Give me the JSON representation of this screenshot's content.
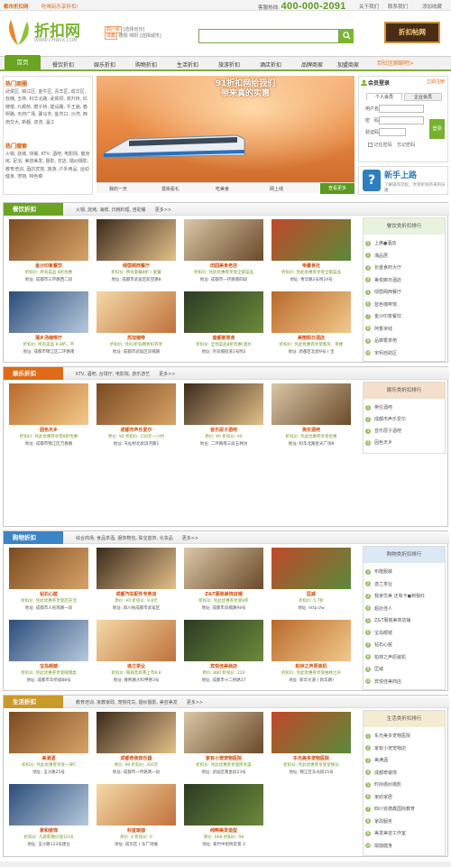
{
  "topbar": {
    "brand": "都市折扣网",
    "slogan": "吃喝玩乐享折扣!",
    "hotline_label": "客服热线:",
    "hotline_number": "400-000-2091",
    "links": [
      "关于我们",
      "联系我们",
      "添加收藏"
    ]
  },
  "header": {
    "logo_cn": "折扣网",
    "logo_en": "WWW.CHWLK.COM",
    "city_current": "四川省",
    "city_select": "[选择省份]",
    "city_row": [
      "成都",
      "德阳",
      "绵阳"
    ],
    "city_select2": "[选择城市]",
    "search_icon": "search-icon",
    "big_button_label": "折扣帖网"
  },
  "nav": {
    "items": [
      "首页",
      "餐饮折扣",
      "娱乐折扣",
      "购物折扣",
      "生活折扣",
      "旅游折扣",
      "酒店折扣",
      "品牌商家",
      "加盟商家"
    ],
    "community": "到社区聊聊吧>"
  },
  "left": {
    "hot_area_title": "热门商圈",
    "hot_area_text": "武侯区, 锦江区, 金牛区, 青羊区, 成华区, 双楠, 玉林, 科华北路, 武侯祠, 高升桥, 红牌楼, 九眼桥, 磨子桥, 建设路, 牛王庙, 春熙路, 天府广场, 骡马市, 盐市口, 沙湾, 西南交大, 新都, 双流, 温江",
    "hot_search_title": "热门搜索",
    "hot_search_text": "火锅, 烧烤, 快餐, KTV, 酒吧, 电影院, 健身房, 足浴, 美容美发, 摄影, 花店, 婚纱摄影, 教育培训, 酒店宾馆, 旅游, 户外用品, 运动健身, 宠物, 特色菜"
  },
  "banner": {
    "headline_1": "91折扣网给我们",
    "headline_2": "带来真的实惠",
    "tabs": [
      "我的一天",
      "逛街看礼",
      "吃美食",
      "网上线"
    ],
    "active_tab": "查看更多"
  },
  "login": {
    "title": "会员登录",
    "register": "立即注册",
    "tabs": [
      "个人会员",
      "企业会员"
    ],
    "user_label": "用户名",
    "pass_label": "密　码",
    "code_label": "验证码",
    "login_button": "登录",
    "remember": "记住密码",
    "forgot": "忘记密码"
  },
  "newuser": {
    "title": "新手上路",
    "text": "了解操作流程，享受折扣带来的乐趣"
  },
  "sections": {
    "food": {
      "tag": "餐饮折扣",
      "keywords": "火锅, 烧烤, 海鲜, 日韩料理, 自助餐　　更多>>",
      "side_title": "餐饮类折扣排行",
      "side_rows": [
        "上席●酒店",
        "湘品居",
        "长盛食府大厅",
        "美悦廊日酒店",
        "绿茵阁西餐厅",
        "蓝色咖啡馆",
        "金沙印象餐饮",
        "阿香米线",
        "品御香茶苑",
        "宋柯自助区"
      ],
      "cards": [
        {
          "title": "金沙印象餐饮",
          "desc": "折扣价: 所有菜品 8折优惠",
          "addr": "地址: 成都市三环路西二段"
        },
        {
          "title": "绿茵阁西餐厅",
          "desc": "折扣价: 所有套餐8折 ( 套餐",
          "addr": "地址: 成都市武侯区航空路8"
        },
        {
          "title": "田园美食老店",
          "desc": "折扣价: 凭此优惠券享受全部菜品",
          "addr": "地址: 成都市一环路南四段"
        },
        {
          "title": "帝豪食社",
          "desc": "折扣价: 凭此优惠券享受全部菜品",
          "addr": "地址: 青华路2号附24号"
        },
        {
          "title": "蒲乡汤咖啡厅",
          "desc": "折扣价: 所有菜品 8.8折，不",
          "addr": "地址: 成都市锦江区二环路南"
        },
        {
          "title": "苏加咖啡",
          "desc": "折扣价: 凭91折扣网折扣券享",
          "addr": "地址: 成都市武侯区双楠路"
        },
        {
          "title": "盘都家常食",
          "desc": "折扣价: 全场菜品8折优惠(酒水",
          "addr": "地址: 外双楠街道1号附2"
        },
        {
          "title": "美丽假日酒店",
          "desc": "折扣价: 凭此优惠券享受客房、茶楼",
          "addr": "地址: 新都区北街9号 ( 宝"
        }
      ]
    },
    "fun": {
      "tag": "娱乐折扣",
      "keywords": "KTV, 酒吧, 台球厅, 电影院, 游乐游艺　　更多>>",
      "side_title": "娱乐类折扣排行",
      "side_rows": [
        "英伦酒吧",
        "成都市声乐爱尔",
        "音乐层子酒吧",
        "固色天乡"
      ],
      "cards": [
        {
          "title": "固色天乡",
          "desc": "折扣价: 凭此优惠券享受8折优惠",
          "addr": "地址: 成都市锦江区万春路"
        },
        {
          "title": "成都市声乐爱尔",
          "desc": "原价: ¥0 折扣价: 150元一小时",
          "addr": "地址: 天仙桥北街滨河路1"
        },
        {
          "title": "音乐层子酒吧",
          "desc": "原价: ¥0 折扣价: ¥0",
          "addr": "地址: 二环路南三段五林坊"
        },
        {
          "title": "英伦酒吧",
          "desc": "折扣价: 凭此优惠券享受优惠",
          "addr": "地址: 科华北路星光广场8"
        }
      ]
    },
    "shop": {
      "tag": "购物折扣",
      "keywords": "综合商场, 食品茶酒, 服饰鞋包, 珠宝首饰, 化妆品　　更多>>",
      "side_title": "购物类折扣排行",
      "side_rows": [
        "布隆服装",
        "逸兰茶业",
        "我家优美 还有卡●到我红",
        "超处佳人",
        "Z&T服装美饰店铺",
        "宝岛眼镜",
        "钻石心脏",
        "柏林之声原装机",
        "匡威",
        "宾悦佳美商店"
      ],
      "cards": [
        {
          "title": "钻石心脏",
          "desc": "折扣价: 凭此优惠券享受店庆活",
          "addr": "地址: 成都市人民南路一段"
        },
        {
          "title": "成都汽车配件专卖店",
          "desc": "原价: ¥0 折扣价: 9.8元",
          "addr": "地址: 四川省成都市武侯区"
        },
        {
          "title": "Z&T服装美饰店铺",
          "desc": "折扣价: 凭此优惠券享受8折",
          "addr": "地址: 成都市双楠路98号"
        },
        {
          "title": "匡威",
          "desc": "折扣价: 5.7折",
          "addr": "地址: http://w"
        },
        {
          "title": "宝岛眼镜",
          "desc": "折扣价: 凭此优惠券享受眼镜类",
          "addr": "地址: 成都市华侨城88号"
        },
        {
          "title": "逸兰茶业",
          "desc": "折扣价: 铁观音新茶上市8.8",
          "addr": "地址: 春熙路大科甲巷3号"
        },
        {
          "title": "宾悦佳美商店",
          "desc": "原价: 880 折扣价: 220",
          "addr": "地址: 成都市十二桥路37"
        },
        {
          "title": "柏林之声原装机",
          "desc": "折扣价: 凭此优惠券享受柏林之声",
          "addr": "地址: 新华大道 ( 新华路)"
        }
      ]
    },
    "life": {
      "tag": "生活折扣",
      "keywords": "教育培训, 家教家政, 宠物花鸟, 婚纱摄影, 美容美发　　更多>>",
      "side_title": "生活类折扣排行",
      "side_rows": [
        "东光美多宠物医院",
        "家有小宠宠物店",
        "美满酒",
        "成都奇装饰",
        "时尚婚纱摄影",
        "家纺家居",
        "四川省德鑫国际教育",
        "家政服务",
        "美发美容工作室",
        "瑜伽健身"
      ],
      "cards": [
        {
          "title": "美满酒",
          "desc": "折扣价: 凭此优惠券享受一律5",
          "addr": "地址: 玉沙路25号"
        },
        {
          "title": "成都奇装饰乐器",
          "desc": "原价: ¥0 折扣价: 300元",
          "addr": "地址: 成都市一环路南一段"
        },
        {
          "title": "家有小宠宠物医院",
          "desc": "折扣价: 凭此优惠券享受所有美",
          "addr": "地址: 武侯区黄金段23号"
        },
        {
          "title": "东光美多宠物医院",
          "desc": "折扣价: 凭此优惠券享受宠物诊",
          "addr": "地址: 锦江区东光街25号"
        },
        {
          "title": "家和装饰",
          "desc": "折扣价: 凡即获赠价值1016",
          "addr": "地址: 玉沙路123号建业"
        },
        {
          "title": "科室瑜伽",
          "desc": "原价: 0 折扣价: 0",
          "addr": "地址: 成华区 ( 东广场展"
        },
        {
          "title": "纯粹美发造型",
          "desc": "原价: 668 折扣价: 98",
          "addr": "地址: 紫竹中街附近第 3"
        }
      ]
    }
  },
  "colors": {
    "green": "#7ab430",
    "orange": "#e06a17",
    "blue": "#3a84c8"
  }
}
